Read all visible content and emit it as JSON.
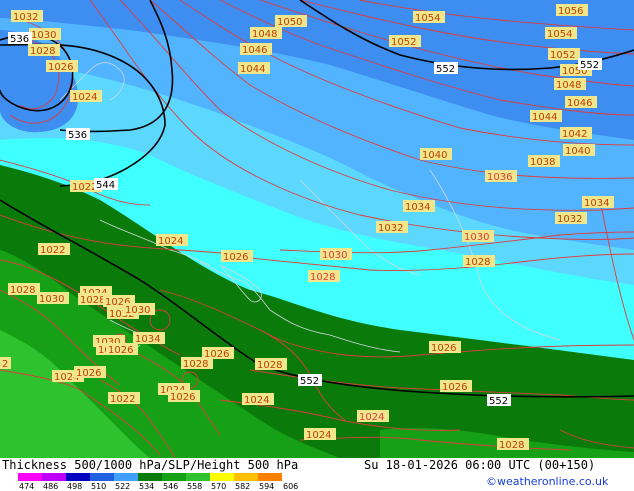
{
  "title": "Thickness 500/1000 hPa/SLP/Height 500 hPa",
  "datetime": "Su 18-01-2026 06:00 UTC (00+150)",
  "credit": "©weatheronline.co.uk",
  "legend": {
    "ticks": [
      "474",
      "486",
      "498",
      "510",
      "522",
      "534",
      "546",
      "558",
      "570",
      "582",
      "594",
      "606"
    ],
    "colors": [
      "#ff00ff",
      "#c000ff",
      "#0000c0",
      "#2060e0",
      "#40a0ff",
      "#0a7a0a",
      "#16a016",
      "#30c030",
      "#ffff00",
      "#ffc000",
      "#ff8000"
    ]
  },
  "colors": {
    "thick_blue": "#3d8ef0",
    "mid_blue": "#52b4ff",
    "light_cyan": "#5cd8ff",
    "cyan": "#40ffff",
    "dark_green": "#0a7a0a",
    "green": "#16a016",
    "bright_green": "#2ec22e",
    "isobar": "#e03c3c",
    "height": "#000000",
    "label_bg": "#f0e68c"
  },
  "pressure_labels": [
    {
      "t": "1032",
      "red": false
    },
    {
      "t": "1030",
      "red": false
    },
    {
      "t": "1028",
      "red": false
    },
    {
      "t": "1026",
      "red": false
    },
    {
      "t": "1024",
      "red": false
    },
    {
      "t": "1050",
      "red": false
    },
    {
      "t": "1048",
      "red": false
    },
    {
      "t": "1046",
      "red": false
    },
    {
      "t": "1044",
      "red": false
    },
    {
      "t": "1054",
      "red": false
    },
    {
      "t": "1052",
      "red": false
    },
    {
      "t": "1056",
      "red": false
    },
    {
      "t": "1054",
      "red": false
    },
    {
      "t": "1052",
      "red": false
    },
    {
      "t": "1050",
      "red": false
    },
    {
      "t": "1048",
      "red": false
    },
    {
      "t": "1046",
      "red": false
    },
    {
      "t": "1044",
      "red": false
    },
    {
      "t": "1042",
      "red": false
    },
    {
      "t": "1040",
      "red": false
    },
    {
      "t": "1040",
      "red": false
    },
    {
      "t": "1038",
      "red": false
    },
    {
      "t": "1036",
      "red": true
    },
    {
      "t": "1034",
      "red": false
    },
    {
      "t": "1034",
      "red": false
    },
    {
      "t": "1032",
      "red": false
    },
    {
      "t": "1032",
      "red": false
    },
    {
      "t": "1030",
      "red": true
    },
    {
      "t": "1030",
      "red": true
    },
    {
      "t": "1028",
      "red": false
    },
    {
      "t": "1028",
      "red": true
    },
    {
      "t": "1022",
      "red": false
    },
    {
      "t": "1022",
      "red": false
    },
    {
      "t": "1024",
      "red": false
    },
    {
      "t": "1026",
      "red": false
    },
    {
      "t": "1028",
      "red": false
    },
    {
      "t": "1030",
      "red": false
    },
    {
      "t": "1024",
      "red": false
    },
    {
      "t": "1028",
      "red": false
    },
    {
      "t": "1026",
      "red": false
    },
    {
      "t": "1032",
      "red": false
    },
    {
      "t": "1030",
      "red": false
    },
    {
      "t": "1034",
      "red": false
    },
    {
      "t": "1030",
      "red": false
    },
    {
      "t": "1028",
      "red": false
    },
    {
      "t": "1026",
      "red": false
    },
    {
      "t": "1028",
      "red": false
    },
    {
      "t": "1028",
      "red": false
    },
    {
      "t": "1024",
      "red": false
    },
    {
      "t": "1026",
      "red": false
    },
    {
      "t": "1022",
      "red": false
    },
    {
      "t": "1024",
      "red": false
    },
    {
      "t": "1026",
      "red": false
    },
    {
      "t": "1024",
      "red": false
    },
    {
      "t": "1024",
      "red": true
    },
    {
      "t": "1024",
      "red": false
    },
    {
      "t": "1026",
      "red": false
    },
    {
      "t": "1026",
      "red": false
    },
    {
      "t": "1026",
      "red": false
    },
    {
      "t": "1028",
      "red": false
    },
    {
      "t": "2",
      "red": false
    }
  ],
  "height_labels": [
    "536",
    "536",
    "544",
    "552",
    "552",
    "552",
    "552"
  ]
}
